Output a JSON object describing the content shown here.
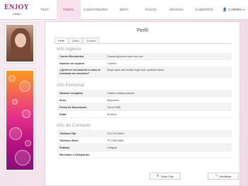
{
  "brand": {
    "name": "ENJOY",
    "sub": "Health"
  },
  "nav": {
    "items": [
      {
        "label": "TEST"
      },
      {
        "label": "PERFIL"
      },
      {
        "label": "CUESTIONARIO"
      },
      {
        "label": "DIETA"
      },
      {
        "label": "PAGOS"
      },
      {
        "label": "GRÁFICA"
      },
      {
        "label": "ALIMENTOS"
      }
    ],
    "active_index": 1,
    "user_label": "CARMEN"
  },
  "panel": {
    "title": "Perfil",
    "tabs": [
      {
        "label": "Perfil"
      },
      {
        "label": "Dieta"
      },
      {
        "label": "Control"
      }
    ],
    "sections": {
      "ingreso": {
        "title": "Info Ingreso",
        "rows": [
          {
            "label": "Correo Electrónico",
            "value": "Carmen@correo-web.com.mx"
          },
          {
            "label": "Nombre de Usuario",
            "value": "Carmen"
          },
          {
            "label": "¿Quién te recomendó o como te enteraste de nosotros?",
            "value": "Sequi quos aut beatae fugif esse quaerat soluta."
          }
        ]
      },
      "personal": {
        "title": "Info Personal",
        "rows": [
          {
            "label": "Nombre Completo",
            "value": "Carmen Malisa Aranda"
          },
          {
            "label": "Sexo",
            "value": "Masculino"
          },
          {
            "label": "Fecha de Nacimiento",
            "value": "7/nov/1985"
          },
          {
            "label": "Edad",
            "value": "29 años"
          }
        ]
      },
      "contacto": {
        "title": "Info de Contacto",
        "rows": [
          {
            "label": "Teléfono Fijo",
            "value": "13-5719-3943"
          },
          {
            "label": "Teléfono Móvil",
            "value": "79-7058-0885"
          },
          {
            "label": "Entidad",
            "value": "Chiapas"
          },
          {
            "label": "Municipio o Delegación",
            "value": ""
          }
        ]
      }
    },
    "buttons": {
      "upload": "Subir Foto",
      "edit": "Modificar"
    }
  }
}
